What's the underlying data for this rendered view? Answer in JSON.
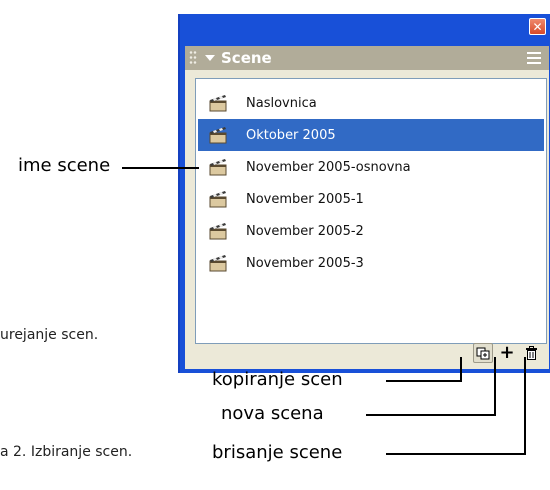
{
  "panel": {
    "title": "Scene",
    "scenes": [
      {
        "name": "Naslovnica",
        "selected": false
      },
      {
        "name": "Oktober 2005",
        "selected": true
      },
      {
        "name": "November 2005-osnovna",
        "selected": false
      },
      {
        "name": "November 2005-1",
        "selected": false
      },
      {
        "name": "November 2005-2",
        "selected": false
      },
      {
        "name": "November 2005-3",
        "selected": false
      }
    ],
    "toolbar": {
      "add_symbol": "+"
    }
  },
  "annotations": {
    "scene_name": "ime scene",
    "copy_scene": "kopiranje scen",
    "new_scene": "nova scena",
    "delete_scene": "brisanje scene"
  },
  "captions": {
    "partial_1": "urejanje scen.",
    "partial_2": "a 2. Izbiranje scen."
  },
  "colors": {
    "window_frame": "#1850d8",
    "panel_header": "#b1ac99",
    "selection": "#316ac5",
    "panel_bg": "#ece9d8"
  }
}
